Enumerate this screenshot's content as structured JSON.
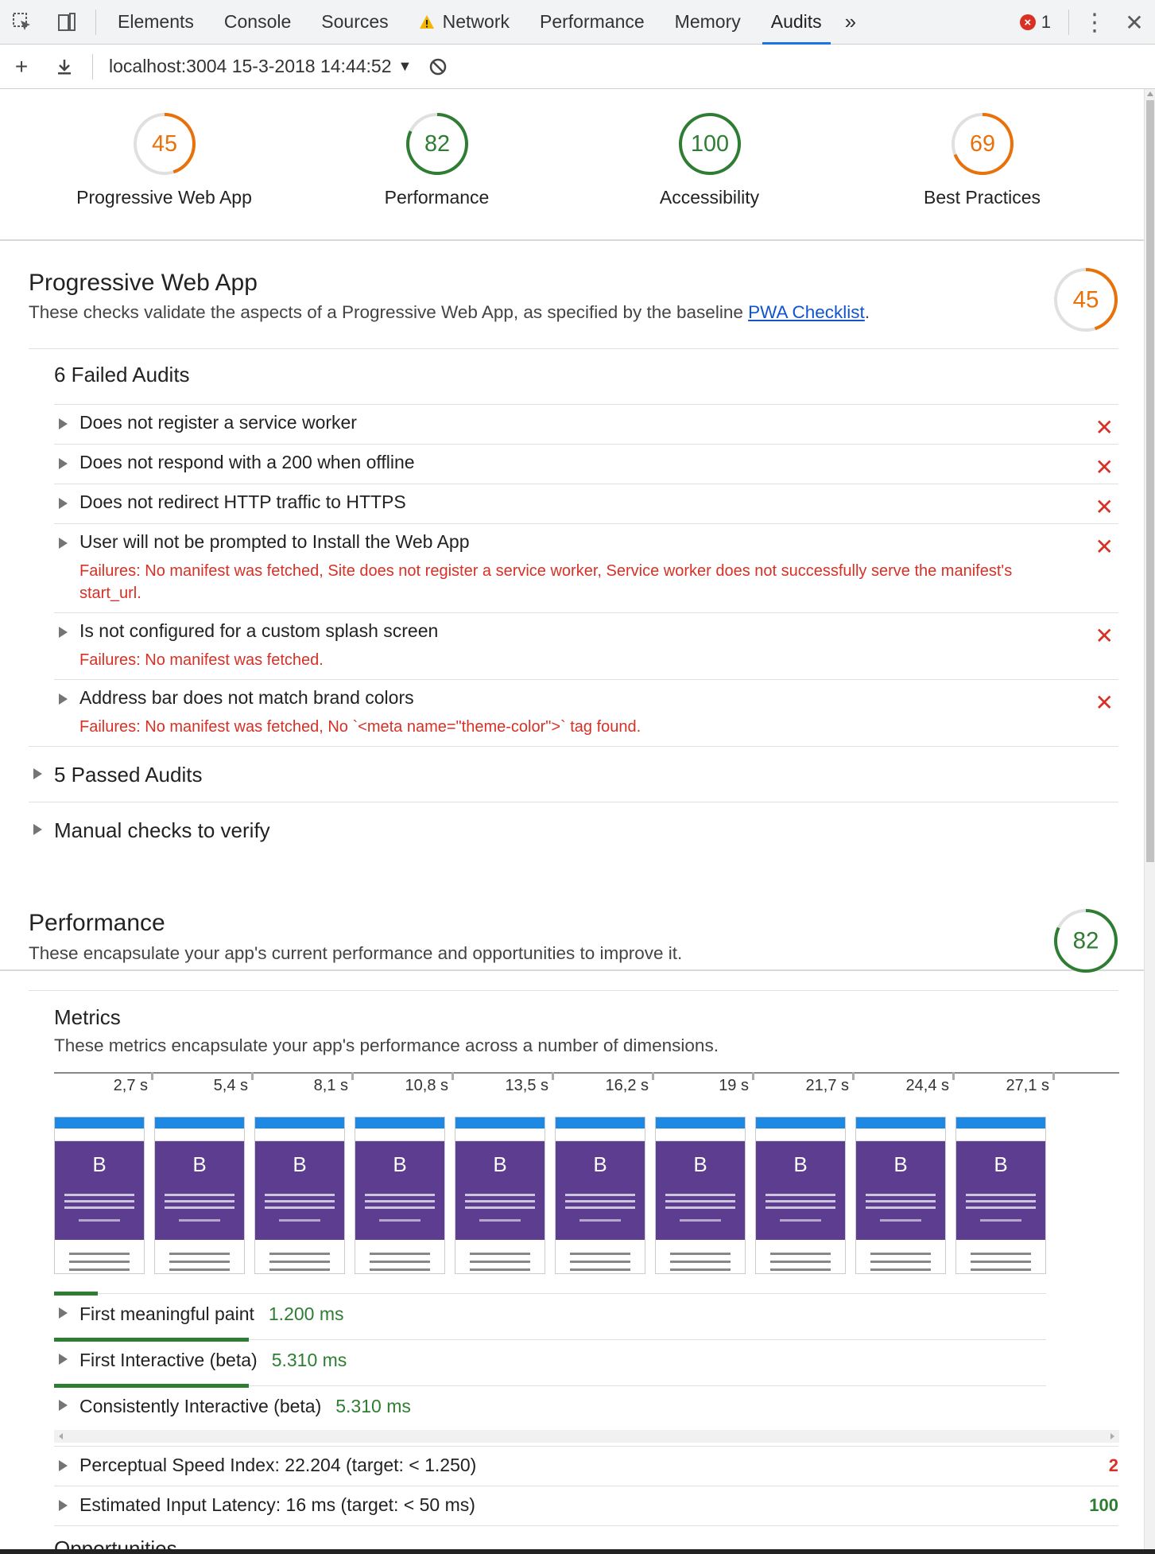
{
  "toolbar": {
    "tabs": [
      "Elements",
      "Console",
      "Sources",
      "Network",
      "Performance",
      "Memory",
      "Audits"
    ],
    "active_tab": "Audits",
    "network_has_warning": true,
    "overflow_glyph": "»",
    "error_count": "1",
    "error_glyph": "×",
    "menu_glyph": "⋮",
    "close_glyph": "✕"
  },
  "report_bar": {
    "add_glyph": "+",
    "download_glyph": "⤓",
    "report_label": "localhost:3004 15-3-2018 14:44:52",
    "caret": "▼"
  },
  "summary_gauges": [
    {
      "score": "45",
      "name": "Progressive Web App",
      "color": "#e8710a"
    },
    {
      "score": "82",
      "name": "Performance",
      "color": "#2e7d32"
    },
    {
      "score": "100",
      "name": "Accessibility",
      "color": "#2e7d32"
    },
    {
      "score": "69",
      "name": "Best Practices",
      "color": "#e8710a"
    }
  ],
  "pwa": {
    "title": "Progressive Web App",
    "description_before": "These checks validate the aspects of a Progressive Web App, as specified by the baseline ",
    "link_text": "PWA Checklist",
    "description_after": ".",
    "score": "45",
    "score_color": "#e8710a",
    "failed_title": "6 Failed Audits",
    "failed_audits": [
      {
        "title": "Does not register a service worker",
        "failure": ""
      },
      {
        "title": "Does not respond with a 200 when offline",
        "failure": ""
      },
      {
        "title": "Does not redirect HTTP traffic to HTTPS",
        "failure": ""
      },
      {
        "title": "User will not be prompted to Install the Web App",
        "failure": "Failures: No manifest was fetched, Site does not register a service worker, Service worker does not successfully serve the manifest's start_url."
      },
      {
        "title": "Is not configured for a custom splash screen",
        "failure": "Failures: No manifest was fetched."
      },
      {
        "title": "Address bar does not match brand colors",
        "failure": "Failures: No manifest was fetched, No `<meta name=\"theme-color\">` tag found."
      }
    ],
    "fail_mark": "✕",
    "passed_title": "5 Passed Audits",
    "manual_title": "Manual checks to verify"
  },
  "performance": {
    "title": "Performance",
    "description": "These encapsulate your app's current performance and opportunities to improve it.",
    "score": "82",
    "score_color": "#2e7d32",
    "metrics_title": "Metrics",
    "metrics_description": "These metrics encapsulate your app's performance across a number of dimensions.",
    "filmstrip_times": [
      "2,7 s",
      "5,4 s",
      "8,1 s",
      "10,8 s",
      "13,5 s",
      "16,2 s",
      "19 s",
      "21,7 s",
      "24,4 s",
      "27,1 s"
    ],
    "frame_logo": "B",
    "timeline_metrics": [
      {
        "name": "First meaningful paint",
        "value": "1.200 ms",
        "timeline_fraction": 0.044
      },
      {
        "name": "First Interactive (beta)",
        "value": "5.310 ms",
        "timeline_fraction": 0.196
      },
      {
        "name": "Consistently Interactive (beta)",
        "value": "5.310 ms",
        "timeline_fraction": 0.196
      }
    ],
    "scored_metrics": [
      {
        "name": "Perceptual Speed Index: 22.204 (target: < 1.250)",
        "score": "2",
        "color": "#d93025"
      },
      {
        "name": "Estimated Input Latency: 16 ms (target: < 50 ms)",
        "score": "100",
        "color": "#2e7d32"
      }
    ],
    "opportunities_title": "Opportunities"
  }
}
